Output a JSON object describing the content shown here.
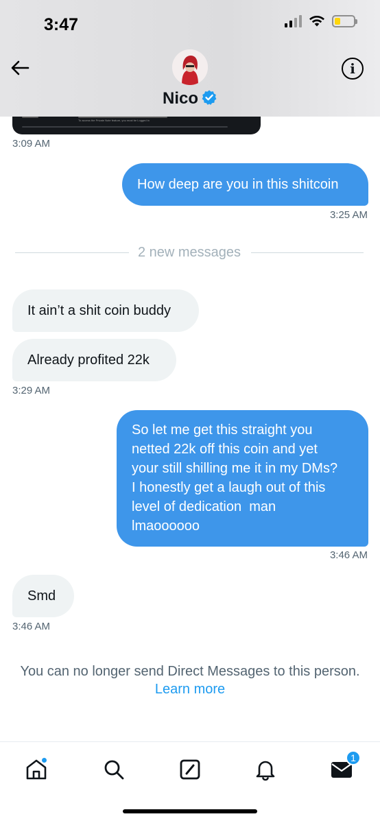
{
  "status_bar": {
    "time": "3:47"
  },
  "header": {
    "contact_name": "Nico"
  },
  "preview_card": {
    "left_text": "Private Note",
    "center_text": "To access the Private Note feature, you must be Logged in"
  },
  "messages": [
    {
      "direction": "in",
      "text": "",
      "time": "3:09 AM"
    },
    {
      "direction": "out",
      "text": "How deep are you in this shitcoin",
      "time": "3:25 AM"
    },
    {
      "direction": "in",
      "text": "It ain’t a shit coin buddy"
    },
    {
      "direction": "in",
      "text": "Already profited 22k",
      "time": "3:29 AM"
    },
    {
      "direction": "out",
      "lines": [
        "So let me get this straight you",
        "netted 22k off this coin and yet",
        "your still shilling me it in my DMs?",
        "I honestly get a laugh out of this",
        "level of dedication  man",
        "lmaoooooo"
      ],
      "time": "3:46 AM"
    },
    {
      "direction": "in",
      "text": "Smd",
      "time": "3:46 AM"
    }
  ],
  "divider_label": "2 new messages",
  "notice": {
    "text": "You can no longer send Direct Messages to this person.",
    "link": "Learn more"
  },
  "tabbar": {
    "items": [
      {
        "icon": "home-icon",
        "indicator": "dot"
      },
      {
        "icon": "search-icon"
      },
      {
        "icon": "compose-icon"
      },
      {
        "icon": "notifications-icon"
      },
      {
        "icon": "messages-icon",
        "badge": "1"
      }
    ]
  },
  "colors": {
    "accent": "#1d9bf0",
    "outgoing_bubble": "#3e96ea",
    "incoming_bubble": "#eff3f4",
    "secondary_text": "#536471"
  }
}
